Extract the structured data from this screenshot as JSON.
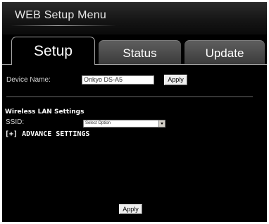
{
  "header": {
    "title": "WEB Setup Menu"
  },
  "tabs": [
    {
      "label": "Setup",
      "active": true
    },
    {
      "label": "Status",
      "active": false
    },
    {
      "label": "Update",
      "active": false
    }
  ],
  "device": {
    "label": "Device Name:",
    "value": "Onkyo DS-A5",
    "apply_label": "Apply"
  },
  "wireless": {
    "heading": "Wireless LAN Settings",
    "ssid_label": "SSID:",
    "ssid_selected": "Select Option",
    "advance_label": "[+] ADVANCE SETTINGS"
  },
  "footer": {
    "apply_label": "Apply"
  },
  "colors": {
    "background": "#000000",
    "text": "#ffffff",
    "inactive_tab": "#4a4a4a",
    "tab_border": "#a6a6a6"
  },
  "icons": {
    "select_arrow": "chevron-down-icon"
  }
}
